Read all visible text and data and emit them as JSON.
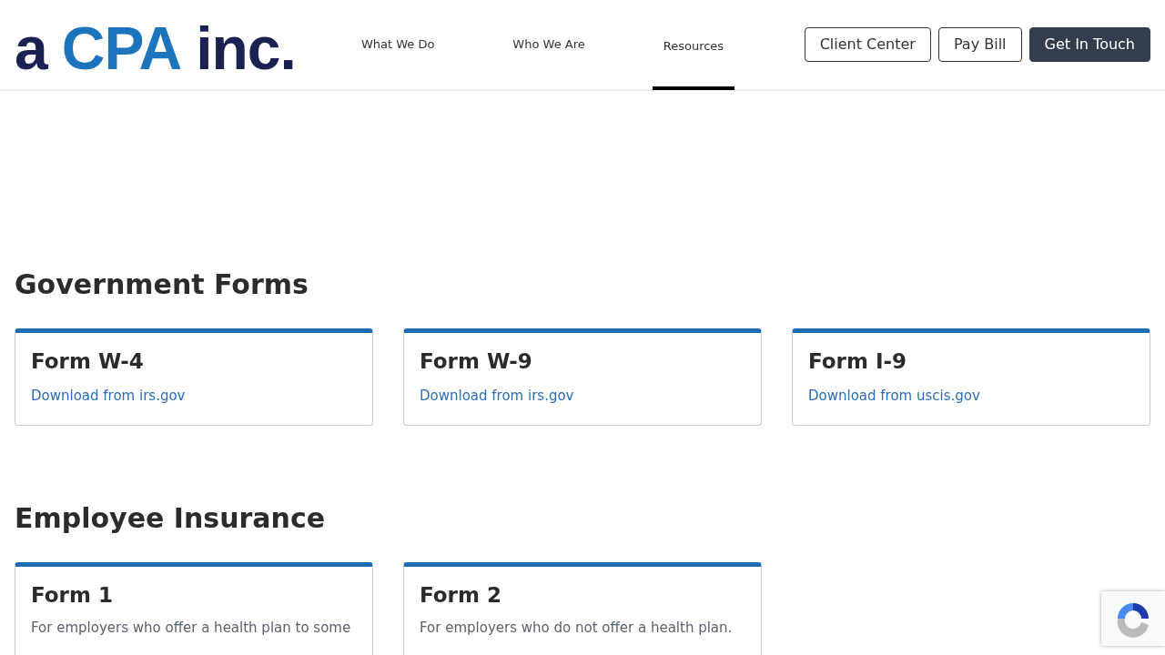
{
  "logo": {
    "prefix": "a",
    "main": "CPA",
    "suffix": "inc."
  },
  "nav": [
    {
      "label": "What We Do",
      "selected": false
    },
    {
      "label": "Who We Are",
      "selected": false
    },
    {
      "label": "Resources",
      "selected": true
    }
  ],
  "buttons": [
    {
      "label": "Client Center",
      "kind": "outline"
    },
    {
      "label": "Pay Bill",
      "kind": "outline"
    },
    {
      "label": "Get In Touch",
      "kind": "solid"
    }
  ],
  "sections": [
    {
      "title": "Government Forms",
      "cards": [
        {
          "title": "Form W-4",
          "kind": "link",
          "text": "Download from irs.gov"
        },
        {
          "title": "Form W-9",
          "kind": "link",
          "text": "Download from irs.gov"
        },
        {
          "title": "Form I-9",
          "kind": "link",
          "text": "Download from uscis.gov"
        }
      ]
    },
    {
      "title": "Employee Insurance",
      "cards": [
        {
          "title": "Form 1",
          "kind": "text",
          "text": "For employers who offer a health plan to some"
        },
        {
          "title": "Form 2",
          "kind": "text",
          "text": "For employers who do not offer a health plan."
        }
      ]
    }
  ]
}
